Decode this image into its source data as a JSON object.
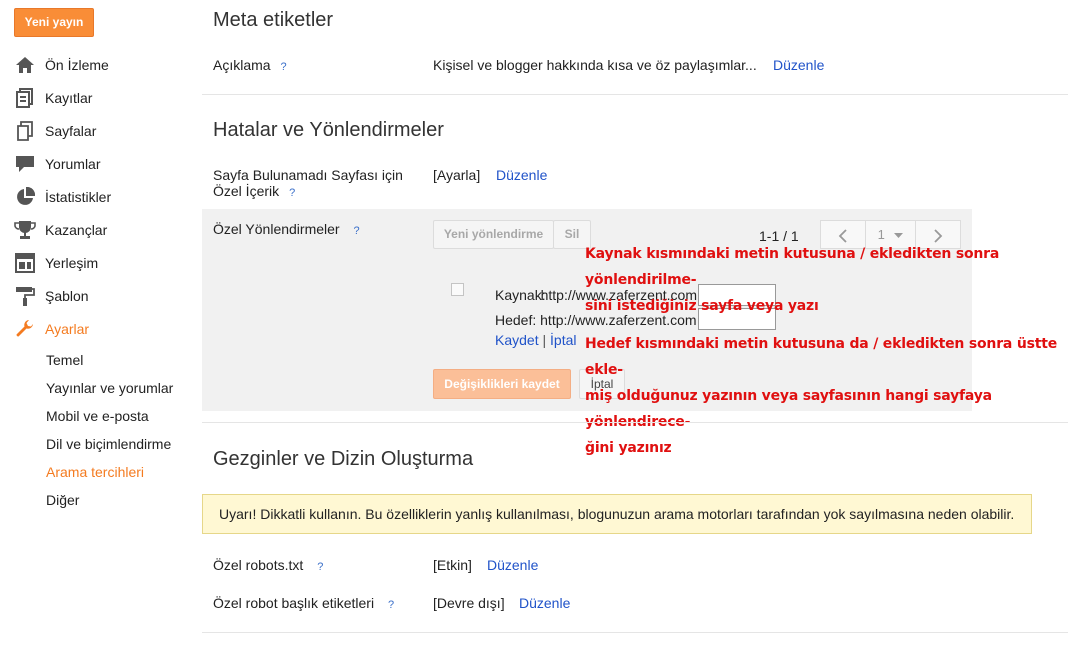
{
  "sidebar": {
    "new_post": "Yeni yayın",
    "items": [
      {
        "label": "Ön İzleme",
        "icon": "home-icon"
      },
      {
        "label": "Kayıtlar",
        "icon": "posts-icon"
      },
      {
        "label": "Sayfalar",
        "icon": "pages-icon"
      },
      {
        "label": "Yorumlar",
        "icon": "comment-icon"
      },
      {
        "label": "İstatistikler",
        "icon": "pie-chart-icon"
      },
      {
        "label": "Kazançlar",
        "icon": "trophy-icon"
      },
      {
        "label": "Yerleşim",
        "icon": "layout-icon"
      },
      {
        "label": "Şablon",
        "icon": "paint-roller-icon"
      },
      {
        "label": "Ayarlar",
        "icon": "wrench-icon"
      }
    ],
    "sub_items": [
      "Temel",
      "Yayınlar ve yorumlar",
      "Mobil ve e-posta",
      "Dil ve biçimlendirme",
      "Arama tercihleri",
      "Diğer"
    ]
  },
  "meta": {
    "title": "Meta etiketler",
    "description_label": "Açıklama",
    "description_value": "Kişisel ve blogger hakkında kısa ve öz paylaşımlar...",
    "edit": "Düzenle"
  },
  "errors": {
    "title": "Hatalar ve Yönlendirmeler",
    "notfound_label_1": "Sayfa Bulunamadı Sayfası için",
    "notfound_label_2": "Özel İçerik",
    "notfound_value": "[Ayarla]",
    "edit": "Düzenle",
    "redirects_label": "Özel Yönlendirmeler",
    "new_redirect": "Yeni yönlendirme",
    "delete": "Sil",
    "pager_text": "1-1 / 1",
    "page_select": "1",
    "source_label": "Kaynak:",
    "source_value": "http://www.zaferzent.com",
    "target_label": "Hedef:",
    "target_value": "http://www.zaferzent.com",
    "save_link": "Kaydet",
    "separator": "|",
    "cancel_link": "İptal",
    "save_changes": "Değişiklikleri kaydet",
    "cancel_button": "İptal",
    "note1_line1": "Kaynak kısmındaki metin kutusuna / ekledikten sonra yönlendirilme-",
    "note1_line2": "sini istediğiniz sayfa veya yazı",
    "note2_line1": "Hedef kısmındaki metin kutusuna da / ekledikten sonra üstte ekle-",
    "note2_line2": "miş olduğunuz yazının veya sayfasının hangi sayfaya yönlendirece-",
    "note2_line3": "ğini yazınız"
  },
  "crawlers": {
    "title": "Gezginler ve Dizin Oluşturma",
    "warning": "Uyarı! Dikkatli kullanın. Bu özelliklerin yanlış kullanılması, blogunuzun arama motorları tarafından yok sayılmasına neden olabilir.",
    "robots_label": "Özel robots.txt",
    "robots_value": "[Etkin]",
    "robot_tags_label": "Özel robot başlık etiketleri",
    "robot_tags_value": "[Devre dışı]",
    "edit": "Düzenle"
  },
  "help_text": "?",
  "colors": {
    "accent": "#f47b20",
    "link": "#2053c9",
    "note": "#e01010"
  }
}
